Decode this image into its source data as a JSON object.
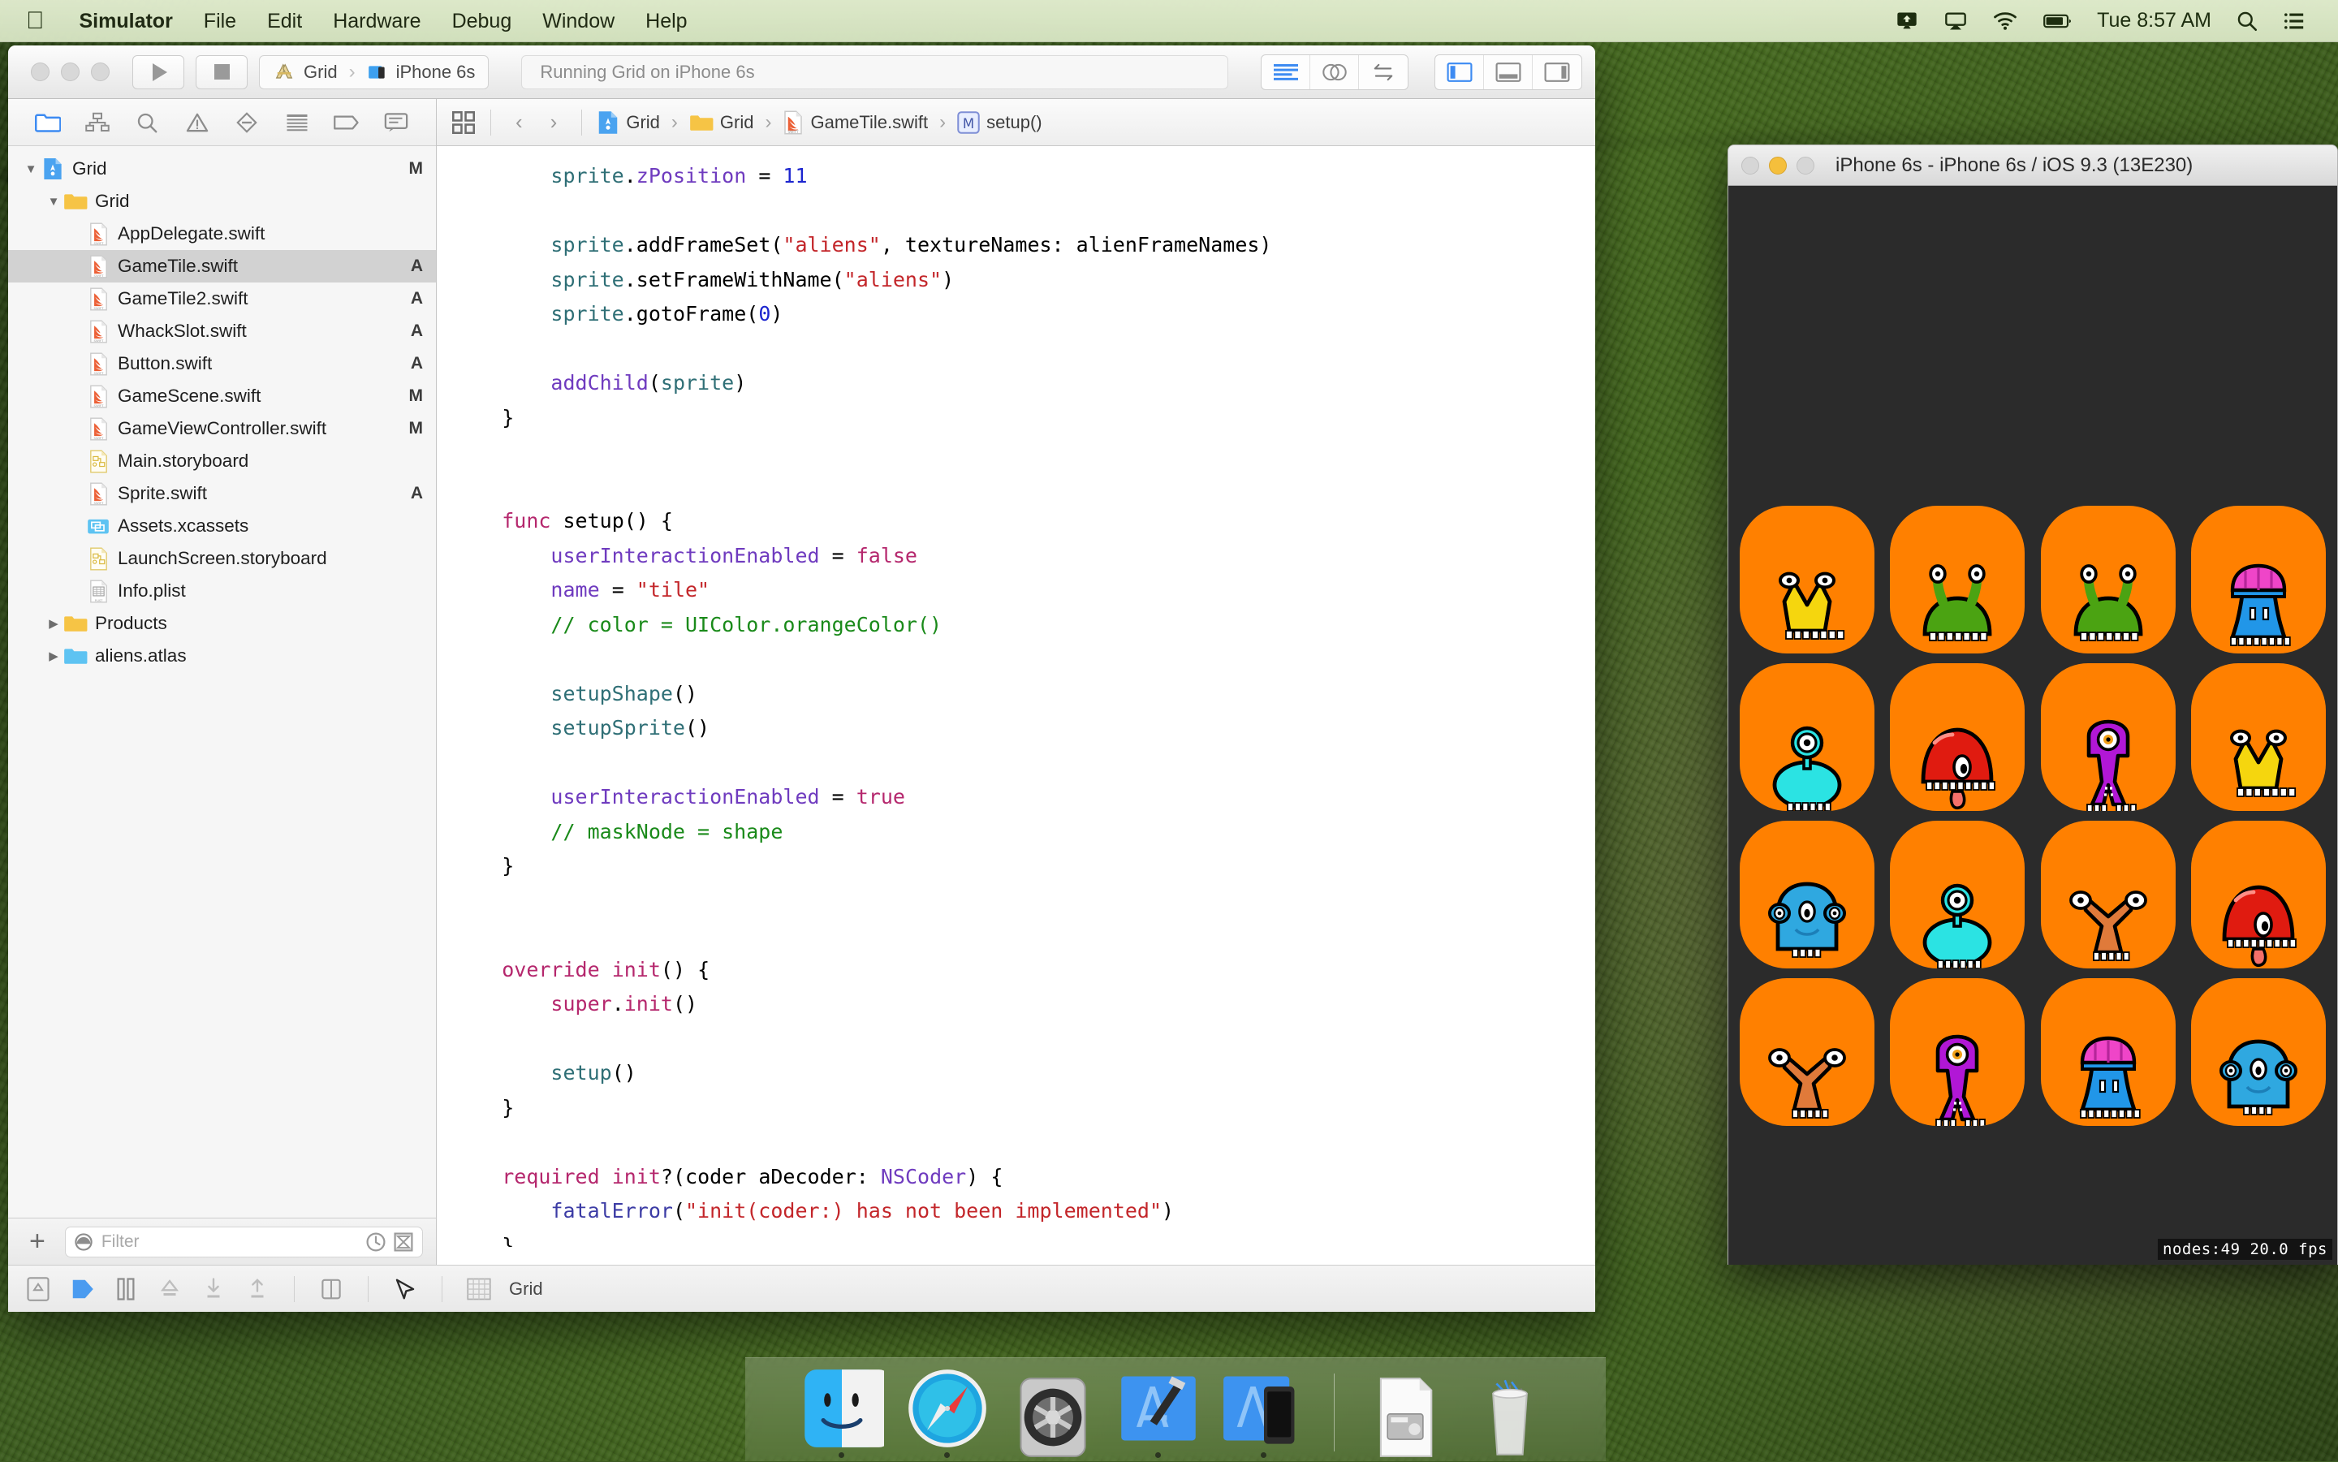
{
  "menubar": {
    "apple_icon": "apple-logo",
    "items": [
      "Simulator",
      "File",
      "Edit",
      "Hardware",
      "Debug",
      "Window",
      "Help"
    ],
    "status_icons": [
      "screen-sharing-icon",
      "airplay-icon",
      "wifi-icon",
      "battery-icon"
    ],
    "clock": "Tue 8:57 AM",
    "search_icon": "search-icon",
    "notification_center_icon": "list-icon"
  },
  "xcode": {
    "toolbar": {
      "run_button": "run-button",
      "stop_button": "stop-button",
      "scheme_name": "Grid",
      "destination_name": "iPhone 6s",
      "status_text": "Running Grid on iPhone 6s",
      "editor_modes": [
        "standard-editor",
        "assistant-editor",
        "version-editor"
      ],
      "view_toggles": [
        "navigator-toggle",
        "debug-area-toggle",
        "utilities-toggle"
      ]
    },
    "navigator": {
      "tabs": [
        "project-navigator",
        "symbol-navigator",
        "find-navigator",
        "issue-navigator",
        "test-navigator",
        "debug-navigator",
        "breakpoint-navigator",
        "report-navigator"
      ],
      "selected_tab": "project-navigator",
      "items": [
        {
          "label": "Grid",
          "icon": "xcode-project-icon",
          "depth": 0,
          "twisty": "down",
          "status": "M",
          "selected": false
        },
        {
          "label": "Grid",
          "icon": "folder-icon",
          "depth": 1,
          "twisty": "down",
          "status": "",
          "selected": false
        },
        {
          "label": "AppDelegate.swift",
          "icon": "swift-file-icon",
          "depth": 2,
          "twisty": "",
          "status": "",
          "selected": false
        },
        {
          "label": "GameTile.swift",
          "icon": "swift-file-icon",
          "depth": 2,
          "twisty": "",
          "status": "A",
          "selected": true
        },
        {
          "label": "GameTile2.swift",
          "icon": "swift-file-icon",
          "depth": 2,
          "twisty": "",
          "status": "A",
          "selected": false
        },
        {
          "label": "WhackSlot.swift",
          "icon": "swift-file-icon",
          "depth": 2,
          "twisty": "",
          "status": "A",
          "selected": false
        },
        {
          "label": "Button.swift",
          "icon": "swift-file-icon",
          "depth": 2,
          "twisty": "",
          "status": "A",
          "selected": false
        },
        {
          "label": "GameScene.swift",
          "icon": "swift-file-icon",
          "depth": 2,
          "twisty": "",
          "status": "M",
          "selected": false
        },
        {
          "label": "GameViewController.swift",
          "icon": "swift-file-icon",
          "depth": 2,
          "twisty": "",
          "status": "M",
          "selected": false
        },
        {
          "label": "Main.storyboard",
          "icon": "storyboard-file-icon",
          "depth": 2,
          "twisty": "",
          "status": "",
          "selected": false
        },
        {
          "label": "Sprite.swift",
          "icon": "swift-file-icon",
          "depth": 2,
          "twisty": "",
          "status": "A",
          "selected": false
        },
        {
          "label": "Assets.xcassets",
          "icon": "xcassets-icon",
          "depth": 2,
          "twisty": "",
          "status": "",
          "selected": false
        },
        {
          "label": "LaunchScreen.storyboard",
          "icon": "storyboard-file-icon",
          "depth": 2,
          "twisty": "",
          "status": "",
          "selected": false
        },
        {
          "label": "Info.plist",
          "icon": "plist-file-icon",
          "depth": 2,
          "twisty": "",
          "status": "",
          "selected": false
        },
        {
          "label": "Products",
          "icon": "folder-icon",
          "depth": 1,
          "twisty": "right",
          "status": "",
          "selected": false
        },
        {
          "label": "aliens.atlas",
          "icon": "blue-folder-icon",
          "depth": 1,
          "twisty": "right",
          "status": "",
          "selected": false
        }
      ],
      "filter": {
        "placeholder": "Filter",
        "add_button": "+",
        "recent_icon": "clock-icon",
        "source-control-icon": "source-control-filter-icon"
      }
    },
    "jumpbar": {
      "related_items_icon": "related-items-icon",
      "back_icon": "back-chevron-icon",
      "forward_icon": "forward-chevron-icon",
      "crumbs": [
        {
          "label": "Grid",
          "icon": "xcode-project-icon"
        },
        {
          "label": "Grid",
          "icon": "folder-icon"
        },
        {
          "label": "GameTile.swift",
          "icon": "swift-file-icon"
        },
        {
          "label": "setup()",
          "icon": "method-icon"
        }
      ]
    },
    "code_lines": [
      [
        {
          "t": "        ",
          "c": "id"
        },
        {
          "t": "sprite",
          "c": "meth"
        },
        {
          "t": ".",
          "c": "id"
        },
        {
          "t": "zPosition",
          "c": "prop"
        },
        {
          "t": " = ",
          "c": "id"
        },
        {
          "t": "11",
          "c": "num"
        }
      ],
      [],
      [
        {
          "t": "        ",
          "c": "id"
        },
        {
          "t": "sprite",
          "c": "meth"
        },
        {
          "t": ".addFrameSet(",
          "c": "id"
        },
        {
          "t": "\"aliens\"",
          "c": "str"
        },
        {
          "t": ", textureNames: alienFrameNames)",
          "c": "id"
        }
      ],
      [
        {
          "t": "        ",
          "c": "id"
        },
        {
          "t": "sprite",
          "c": "meth"
        },
        {
          "t": ".setFrameWithName(",
          "c": "id"
        },
        {
          "t": "\"aliens\"",
          "c": "str"
        },
        {
          "t": ")",
          "c": "id"
        }
      ],
      [
        {
          "t": "        ",
          "c": "id"
        },
        {
          "t": "sprite",
          "c": "meth"
        },
        {
          "t": ".gotoFrame(",
          "c": "id"
        },
        {
          "t": "0",
          "c": "num"
        },
        {
          "t": ")",
          "c": "id"
        }
      ],
      [],
      [
        {
          "t": "        ",
          "c": "id"
        },
        {
          "t": "addChild",
          "c": "prop"
        },
        {
          "t": "(",
          "c": "id"
        },
        {
          "t": "sprite",
          "c": "meth"
        },
        {
          "t": ")",
          "c": "id"
        }
      ],
      [
        {
          "t": "    }",
          "c": "id"
        }
      ],
      [],
      [],
      [
        {
          "t": "    ",
          "c": "id"
        },
        {
          "t": "func",
          "c": "kw"
        },
        {
          "t": " setup() {",
          "c": "id"
        }
      ],
      [
        {
          "t": "        ",
          "c": "id"
        },
        {
          "t": "userInteractionEnabled",
          "c": "prop"
        },
        {
          "t": " = ",
          "c": "id"
        },
        {
          "t": "false",
          "c": "kw"
        }
      ],
      [
        {
          "t": "        ",
          "c": "id"
        },
        {
          "t": "name",
          "c": "prop"
        },
        {
          "t": " = ",
          "c": "id"
        },
        {
          "t": "\"tile\"",
          "c": "str"
        }
      ],
      [
        {
          "t": "        // color = UIColor.orangeColor()",
          "c": "cmt"
        }
      ],
      [],
      [
        {
          "t": "        ",
          "c": "id"
        },
        {
          "t": "setupShape",
          "c": "meth"
        },
        {
          "t": "()",
          "c": "id"
        }
      ],
      [
        {
          "t": "        ",
          "c": "id"
        },
        {
          "t": "setupSprite",
          "c": "meth"
        },
        {
          "t": "()",
          "c": "id"
        }
      ],
      [],
      [
        {
          "t": "        ",
          "c": "id"
        },
        {
          "t": "userInteractionEnabled",
          "c": "prop"
        },
        {
          "t": " = ",
          "c": "id"
        },
        {
          "t": "true",
          "c": "kw"
        }
      ],
      [
        {
          "t": "        // maskNode = shape",
          "c": "cmt"
        }
      ],
      [
        {
          "t": "    }",
          "c": "id"
        }
      ],
      [],
      [],
      [
        {
          "t": "    ",
          "c": "id"
        },
        {
          "t": "override",
          "c": "kw"
        },
        {
          "t": " ",
          "c": "id"
        },
        {
          "t": "init",
          "c": "kw"
        },
        {
          "t": "() {",
          "c": "id"
        }
      ],
      [
        {
          "t": "        ",
          "c": "id"
        },
        {
          "t": "super",
          "c": "kw"
        },
        {
          "t": ".",
          "c": "id"
        },
        {
          "t": "init",
          "c": "kw"
        },
        {
          "t": "()",
          "c": "id"
        }
      ],
      [],
      [
        {
          "t": "        ",
          "c": "id"
        },
        {
          "t": "setup",
          "c": "meth"
        },
        {
          "t": "()",
          "c": "id"
        }
      ],
      [
        {
          "t": "    }",
          "c": "id"
        }
      ],
      [],
      [
        {
          "t": "    ",
          "c": "id"
        },
        {
          "t": "required",
          "c": "kw"
        },
        {
          "t": " ",
          "c": "id"
        },
        {
          "t": "init",
          "c": "kw"
        },
        {
          "t": "?(coder aDecoder: ",
          "c": "id"
        },
        {
          "t": "NSCoder",
          "c": "typ"
        },
        {
          "t": ") {",
          "c": "id"
        }
      ],
      [
        {
          "t": "        ",
          "c": "id"
        },
        {
          "t": "fatalError",
          "c": "sys"
        },
        {
          "t": "(",
          "c": "id"
        },
        {
          "t": "\"init(coder:) has not been implemented\"",
          "c": "str"
        },
        {
          "t": ")",
          "c": "id"
        }
      ],
      [
        {
          "t": "    }",
          "c": "id"
        }
      ],
      [
        {
          "t": "}",
          "c": "id"
        }
      ]
    ],
    "debugbar": {
      "icons": [
        "hide-debug-area-icon",
        "continue-icon",
        "pause-icon",
        "step-over-icon",
        "step-into-icon",
        "step-out-icon",
        "view-debugging-icon",
        "location-simulate-icon"
      ],
      "process_label": "Grid",
      "process_icon": "grid-process-icon"
    }
  },
  "simulator": {
    "window_title": "iPhone 6s - iPhone 6s / iOS 9.3 (13E230)",
    "traffic_lights": [
      "close-button",
      "minimize-button",
      "zoom-button"
    ],
    "screen_bg": "#2b2b2b",
    "tile_color": "#FF8000",
    "fps_label": "nodes:49   20.0  fps",
    "grid": {
      "columns": 4,
      "rows": 4,
      "tiles": [
        {
          "alien": "yellow-snail-alien",
          "color": "#F5D60E"
        },
        {
          "alien": "green-slug-alien",
          "color": "#4BA312"
        },
        {
          "alien": "green-slug-alien",
          "color": "#4BA312"
        },
        {
          "alien": "blue-brain-alien",
          "color": "#2196E8"
        },
        {
          "alien": "cyan-eye-alien",
          "color": "#2BE3E3"
        },
        {
          "alien": "red-tongue-alien",
          "color": "#E01B10"
        },
        {
          "alien": "purple-octopus-alien",
          "color": "#B117D6"
        },
        {
          "alien": "yellow-snail-alien",
          "color": "#F5D60E"
        },
        {
          "alien": "blue-blob-alien",
          "color": "#2FA8E0"
        },
        {
          "alien": "cyan-eye-alien",
          "color": "#2BE3E3"
        },
        {
          "alien": "orange-hammer-alien",
          "color": "#E07A3A"
        },
        {
          "alien": "red-tongue-alien",
          "color": "#E01B10"
        },
        {
          "alien": "orange-hammer-alien",
          "color": "#E07A3A"
        },
        {
          "alien": "purple-octopus-alien",
          "color": "#B117D6"
        },
        {
          "alien": "blue-brain-alien",
          "color": "#2196E8"
        },
        {
          "alien": "blue-blob-alien",
          "color": "#2FA8E0"
        }
      ]
    }
  },
  "dock": {
    "items": [
      {
        "name": "finder",
        "icon": "finder-icon",
        "running": true
      },
      {
        "name": "safari",
        "icon": "safari-icon",
        "running": true
      },
      {
        "name": "system-preferences",
        "icon": "system-preferences-icon",
        "running": false
      },
      {
        "name": "xcode",
        "icon": "xcode-icon",
        "running": true
      },
      {
        "name": "simulator",
        "icon": "simulator-icon",
        "running": true
      }
    ],
    "right_items": [
      {
        "name": "disk-image",
        "icon": "disk-image-icon"
      },
      {
        "name": "trash",
        "icon": "trash-icon"
      }
    ]
  }
}
